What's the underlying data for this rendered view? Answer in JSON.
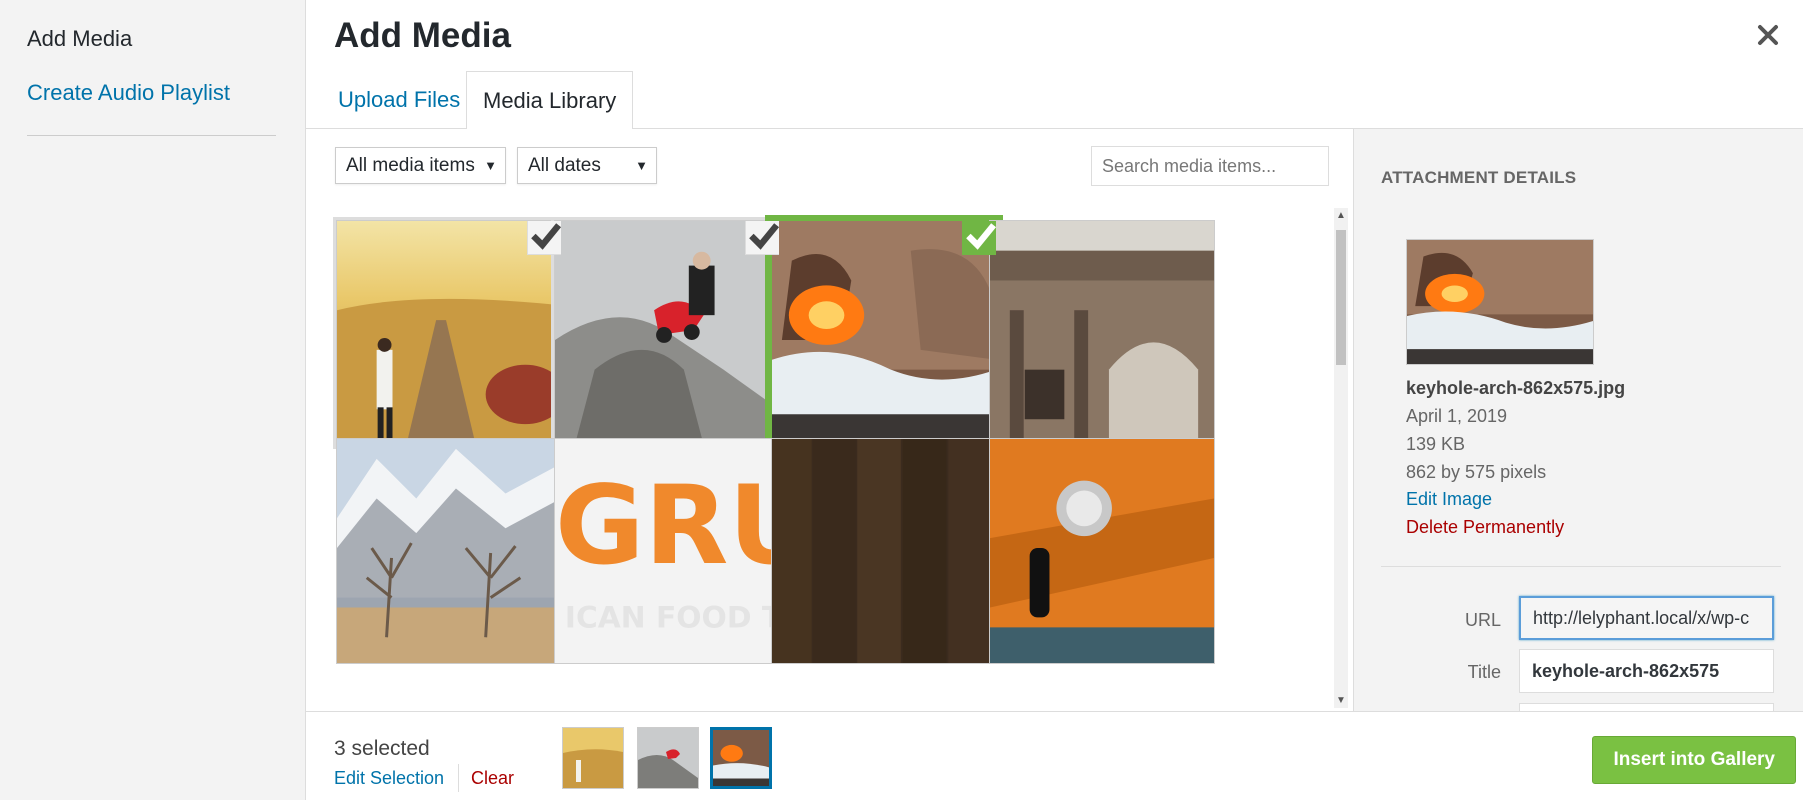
{
  "menu": {
    "active_label": "Add Media",
    "playlist_label": "Create Audio Playlist"
  },
  "header": {
    "title": "Add Media",
    "close_icon": "close-icon"
  },
  "tabs": [
    {
      "label": "Upload Files",
      "active": false
    },
    {
      "label": "Media Library",
      "active": true
    }
  ],
  "filters": {
    "type_selected": "All media items",
    "date_selected": "All dates",
    "search_placeholder": "Search media items..."
  },
  "attachment": {
    "heading": "Attachment Details",
    "filename": "keyhole-arch-862x575.jpg",
    "date": "April 1, 2019",
    "size": "139 KB",
    "dimensions": "862 by 575 pixels",
    "edit_label": "Edit Image",
    "delete_label": "Delete Permanently",
    "url_label": "URL",
    "url_value": "http://lelyphant.local/x/wp-c",
    "title_label": "Title",
    "title_value": "keyhole-arch-862x575"
  },
  "toolbar": {
    "count_label": "3 selected",
    "edit_selection_label": "Edit Selection",
    "clear_label": "Clear",
    "insert_label": "Insert into Gallery"
  },
  "colors": {
    "accent": "#0073aa",
    "selected_green": "#70b644",
    "danger": "#a00"
  }
}
